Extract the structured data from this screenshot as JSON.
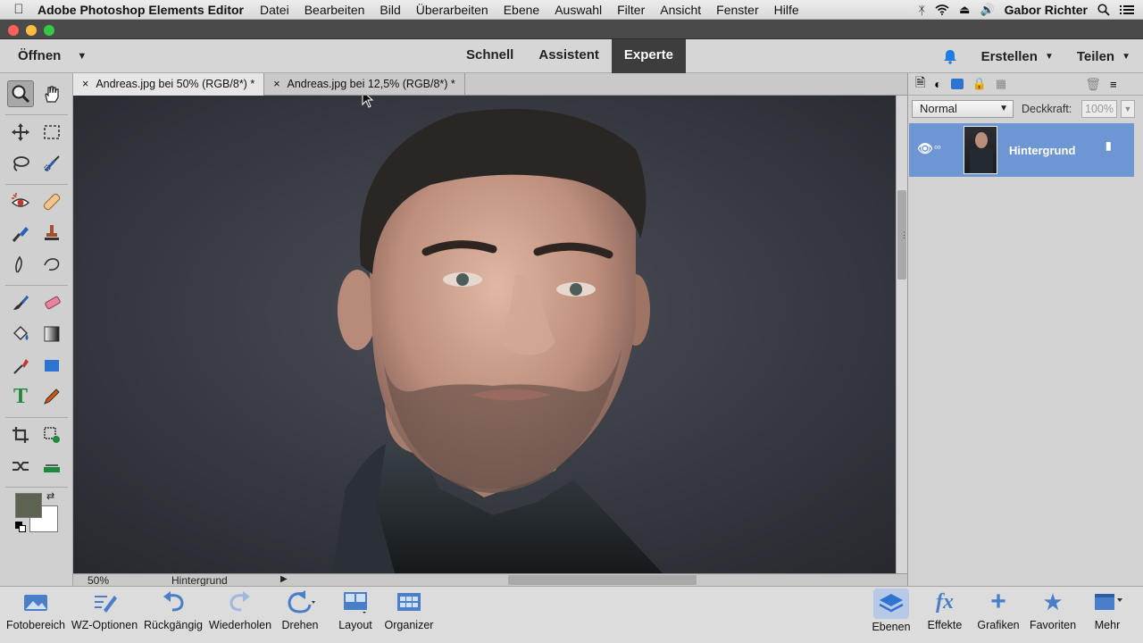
{
  "menubar": {
    "app_name": "Adobe Photoshop Elements Editor",
    "items": [
      "Datei",
      "Bearbeiten",
      "Bild",
      "Überarbeiten",
      "Ebene",
      "Auswahl",
      "Filter",
      "Ansicht",
      "Fenster",
      "Hilfe"
    ],
    "user": "Gabor Richter"
  },
  "topbar": {
    "open_label": "Öffnen",
    "modes": [
      "Schnell",
      "Assistent",
      "Experte"
    ],
    "active_mode": "Experte",
    "create_label": "Erstellen",
    "share_label": "Teilen"
  },
  "tabs": [
    {
      "label": "Andreas.jpg bei 50% (RGB/8*) *",
      "active": true
    },
    {
      "label": "Andreas.jpg bei 12,5% (RGB/8*) *",
      "active": false
    }
  ],
  "status": {
    "zoom": "50%",
    "info": "Hintergrund"
  },
  "layers_panel": {
    "blend_mode": "Normal",
    "opacity_label": "Deckkraft:",
    "opacity_value": "100%",
    "layer_name": "Hintergrund"
  },
  "bottombar": {
    "left": [
      "Fotobereich",
      "WZ-Optionen",
      "Rückgängig",
      "Wiederholen",
      "Drehen",
      "Layout",
      "Organizer"
    ],
    "right": [
      "Ebenen",
      "Effekte",
      "Grafiken",
      "Favoriten",
      "Mehr"
    ]
  },
  "colors": {
    "accent": "#6f96d4",
    "active_mode_bg": "#3d3d3d",
    "foreground_swatch": "#5c6352",
    "background_swatch": "#ffffff"
  }
}
